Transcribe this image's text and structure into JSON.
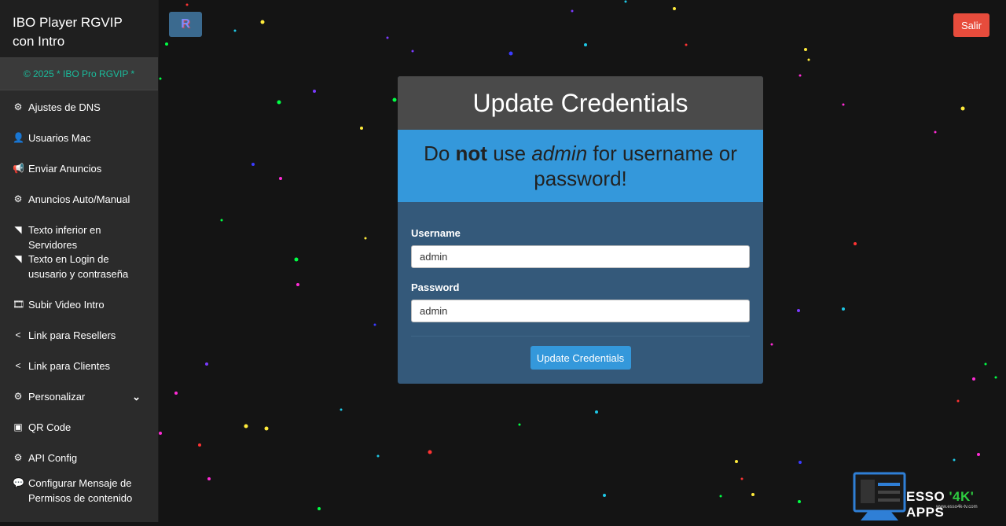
{
  "brand": {
    "title": "IBO Player RGVIP con Intro",
    "copyright": "© 2025 * IBO Pro RGVIP *"
  },
  "sidebar": {
    "items": [
      {
        "label": "Ajustes de DNS",
        "icon": "cogs-icon"
      },
      {
        "label": "Usuarios Mac",
        "icon": "user-icon"
      },
      {
        "label": "Enviar Anuncios",
        "icon": "bullhorn-icon"
      },
      {
        "label": "Anuncios Auto/Manual",
        "icon": "cogs-icon"
      },
      {
        "label": "Texto inferior en Servidores",
        "icon": "rss-icon"
      },
      {
        "label": "Texto en Login de ususario y contraseña",
        "icon": "rss-icon"
      },
      {
        "label": "Subir Video Intro",
        "icon": "film-icon"
      },
      {
        "label": "Link para Resellers",
        "icon": "share-icon"
      },
      {
        "label": "Link para Clientes",
        "icon": "share-icon"
      },
      {
        "label": "Personalizar",
        "icon": "cogs-icon"
      },
      {
        "label": "QR Code",
        "icon": "image-icon"
      },
      {
        "label": "API Config",
        "icon": "cogs-icon"
      },
      {
        "label": "Configurar Mensaje de Permisos de contenido",
        "icon": "comment-icon"
      }
    ]
  },
  "header": {
    "logout_label": "Salir"
  },
  "card": {
    "title": "Update Credentials",
    "alert": {
      "pre": "Do ",
      "bold": "not",
      "mid": " use ",
      "italic": "admin",
      "post": " for username or password!"
    },
    "username_label": "Username",
    "username_value": "admin",
    "password_label": "Password",
    "password_value": "admin",
    "submit_label": "Update Credentials"
  },
  "watermark": {
    "text_a": "ESSO ",
    "text_q": "'4K'",
    "text_b": " APPS",
    "sub": "www.esso4k-tv.com"
  },
  "colors": {
    "accent": "#3498db",
    "danger": "#e74c3c",
    "card": "#34597a",
    "copyright": "#1abc9c"
  }
}
